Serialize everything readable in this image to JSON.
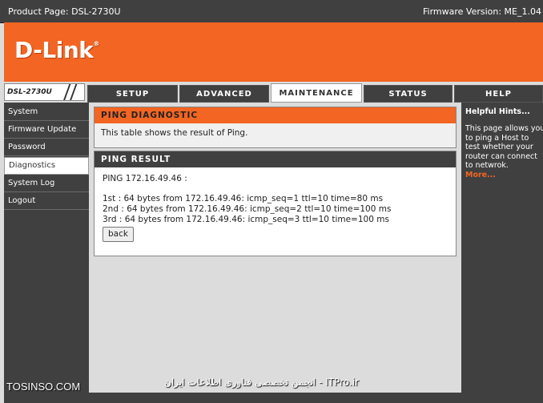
{
  "topbar": {
    "product": "Product Page: DSL-2730U",
    "firmware": "Firmware Version: ME_1.04"
  },
  "brand": {
    "logo": "D-Link"
  },
  "model_label": "DSL-2730U",
  "tabs": [
    {
      "label": "SETUP"
    },
    {
      "label": "ADVANCED"
    },
    {
      "label": "MAINTENANCE"
    },
    {
      "label": "STATUS"
    },
    {
      "label": "HELP"
    }
  ],
  "sidebar": {
    "items": [
      {
        "label": "System"
      },
      {
        "label": "Firmware Update"
      },
      {
        "label": "Password"
      },
      {
        "label": "Diagnostics"
      },
      {
        "label": "System Log"
      },
      {
        "label": "Logout"
      }
    ]
  },
  "diagnostic": {
    "title": "PING DIAGNOSTIC",
    "text": "This table shows the result of Ping."
  },
  "result": {
    "title": "PING RESULT",
    "host_line": "PING 172.16.49.46 :",
    "lines": [
      "1st : 64 bytes from 172.16.49.46: icmp_seq=1 ttl=10 time=80 ms",
      "2nd : 64 bytes from 172.16.49.46: icmp_seq=2 ttl=10 time=100 ms",
      "3rd : 64 bytes from 172.16.49.46: icmp_seq=3 ttl=10 time=100 ms"
    ],
    "back_label": "back"
  },
  "hints": {
    "title": "Helpful Hints...",
    "text": "This page allows you to ping a Host to test whether your router can connect to netwrok.",
    "more": "More..."
  },
  "watermark": {
    "left": "TOSINSO.COM",
    "center": "ITPro.ir - انجمن تخصصی فناوری اطلاعات ایران"
  },
  "colors": {
    "accent": "#f26522",
    "dark": "#404040",
    "background": "#dcdcdc"
  }
}
